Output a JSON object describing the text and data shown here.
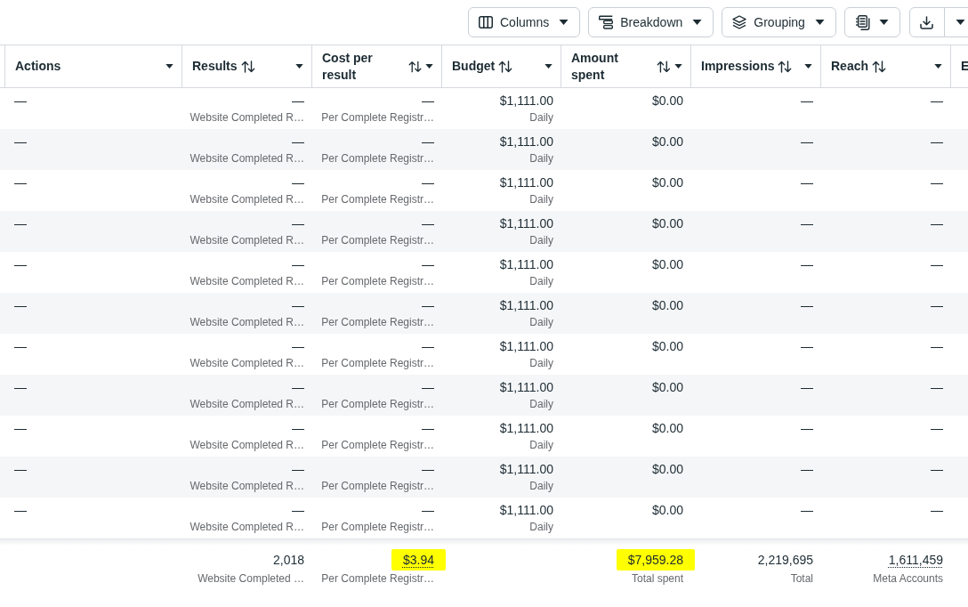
{
  "toolbar": {
    "buttons": [
      {
        "kind": "labeled",
        "label": "Columns"
      },
      {
        "kind": "labeled",
        "label": "Breakdown"
      },
      {
        "kind": "labeled",
        "label": "Grouping"
      },
      {
        "kind": "icon_menu"
      },
      {
        "kind": "split"
      }
    ]
  },
  "table": {
    "columns": [
      {
        "label": "Actions",
        "sortable": false,
        "menu": true
      },
      {
        "label": "Results",
        "sortable": true,
        "menu": true
      },
      {
        "label": "Cost per result",
        "sortable": true,
        "menu": true
      },
      {
        "label": "Budget",
        "sortable": true,
        "menu": true
      },
      {
        "label": "Amount spent",
        "sortable": true,
        "menu": true
      },
      {
        "label": "Impressions",
        "sortable": true,
        "menu": true
      },
      {
        "label": "Reach",
        "sortable": true,
        "menu": true
      },
      {
        "label": "E"
      }
    ],
    "rows": [
      {
        "cells": [
          {
            "value": "—"
          },
          {
            "value": "—",
            "caption": "Website Completed R…"
          },
          {
            "value": "—",
            "caption": "Per Complete Registr…"
          },
          {
            "value": "$1,111.00",
            "caption": "Daily"
          },
          {
            "value": "$0.00"
          },
          {
            "value": "—"
          },
          {
            "value": "—"
          }
        ]
      },
      {
        "cells": [
          {
            "value": "—"
          },
          {
            "value": "—",
            "caption": "Website Completed R…"
          },
          {
            "value": "—",
            "caption": "Per Complete Registr…"
          },
          {
            "value": "$1,111.00",
            "caption": "Daily"
          },
          {
            "value": "$0.00"
          },
          {
            "value": "—"
          },
          {
            "value": "—"
          }
        ]
      },
      {
        "cells": [
          {
            "value": "—"
          },
          {
            "value": "—",
            "caption": "Website Completed R…"
          },
          {
            "value": "—",
            "caption": "Per Complete Registr…"
          },
          {
            "value": "$1,111.00",
            "caption": "Daily"
          },
          {
            "value": "$0.00"
          },
          {
            "value": "—"
          },
          {
            "value": "—"
          }
        ]
      },
      {
        "cells": [
          {
            "value": "—"
          },
          {
            "value": "—",
            "caption": "Website Completed R…"
          },
          {
            "value": "—",
            "caption": "Per Complete Registr…"
          },
          {
            "value": "$1,111.00",
            "caption": "Daily"
          },
          {
            "value": "$0.00"
          },
          {
            "value": "—"
          },
          {
            "value": "—"
          }
        ]
      },
      {
        "cells": [
          {
            "value": "—"
          },
          {
            "value": "—",
            "caption": "Website Completed R…"
          },
          {
            "value": "—",
            "caption": "Per Complete Registr…"
          },
          {
            "value": "$1,111.00",
            "caption": "Daily"
          },
          {
            "value": "$0.00"
          },
          {
            "value": "—"
          },
          {
            "value": "—"
          }
        ]
      },
      {
        "cells": [
          {
            "value": "—"
          },
          {
            "value": "—",
            "caption": "Website Completed R…"
          },
          {
            "value": "—",
            "caption": "Per Complete Registr…"
          },
          {
            "value": "$1,111.00",
            "caption": "Daily"
          },
          {
            "value": "$0.00"
          },
          {
            "value": "—"
          },
          {
            "value": "—"
          }
        ]
      },
      {
        "cells": [
          {
            "value": "—"
          },
          {
            "value": "—",
            "caption": "Website Completed R…"
          },
          {
            "value": "—",
            "caption": "Per Complete Registr…"
          },
          {
            "value": "$1,111.00",
            "caption": "Daily"
          },
          {
            "value": "$0.00"
          },
          {
            "value": "—"
          },
          {
            "value": "—"
          }
        ]
      },
      {
        "cells": [
          {
            "value": "—"
          },
          {
            "value": "—",
            "caption": "Website Completed R…"
          },
          {
            "value": "—",
            "caption": "Per Complete Registr…"
          },
          {
            "value": "$1,111.00",
            "caption": "Daily"
          },
          {
            "value": "$0.00"
          },
          {
            "value": "—"
          },
          {
            "value": "—"
          }
        ]
      },
      {
        "cells": [
          {
            "value": "—"
          },
          {
            "value": "—",
            "caption": "Website Completed R…"
          },
          {
            "value": "—",
            "caption": "Per Complete Registr…"
          },
          {
            "value": "$1,111.00",
            "caption": "Daily"
          },
          {
            "value": "$0.00"
          },
          {
            "value": "—"
          },
          {
            "value": "—"
          }
        ]
      },
      {
        "cells": [
          {
            "value": "—"
          },
          {
            "value": "—",
            "caption": "Website Completed R…"
          },
          {
            "value": "—",
            "caption": "Per Complete Registr…"
          },
          {
            "value": "$1,111.00",
            "caption": "Daily"
          },
          {
            "value": "$0.00"
          },
          {
            "value": "—"
          },
          {
            "value": "—"
          }
        ]
      },
      {
        "cells": [
          {
            "value": "—"
          },
          {
            "value": "—",
            "caption": "Website Completed R…"
          },
          {
            "value": "—",
            "caption": "Per Complete Registr…"
          },
          {
            "value": "$1,111.00",
            "caption": "Daily"
          },
          {
            "value": "$0.00"
          },
          {
            "value": "—"
          },
          {
            "value": "—"
          }
        ]
      }
    ],
    "totals": [
      {
        "kind": "blank"
      },
      {
        "kind": "total",
        "value": "2,018",
        "caption": "Website Completed …",
        "highlighted": false,
        "underlined": false
      },
      {
        "kind": "total",
        "value": "$3.94",
        "caption": "Per Complete Registr…",
        "highlighted": true,
        "underlined": true
      },
      {
        "kind": "blank"
      },
      {
        "kind": "total",
        "value": "$7,959.28",
        "caption": "Total spent",
        "highlighted": true,
        "underlined": false
      },
      {
        "kind": "total",
        "value": "2,219,695",
        "caption": "Total",
        "highlighted": false,
        "underlined": false
      },
      {
        "kind": "total",
        "value": "1,611,459",
        "caption": "Meta Accounts",
        "highlighted": false,
        "underlined": true
      }
    ]
  }
}
